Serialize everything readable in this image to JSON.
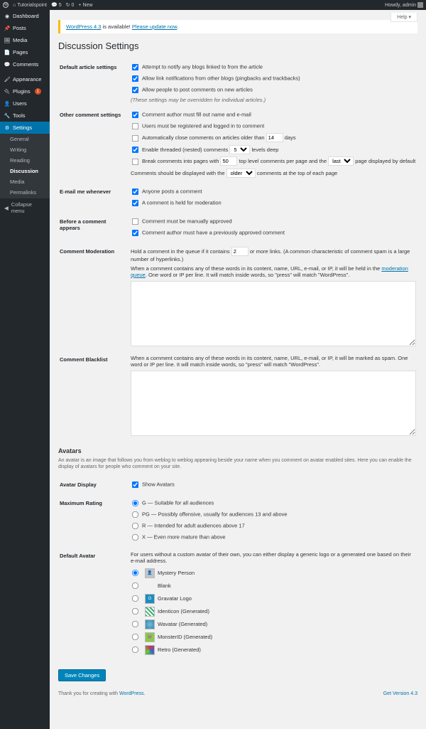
{
  "toolbar": {
    "site_name": "Tutorialspoint",
    "comments_count": "5",
    "updates_count": "0",
    "new_label": "New",
    "greeting": "Howdy, admin"
  },
  "help_tab": "Help ▾",
  "sidebar": {
    "dashboard": "Dashboard",
    "posts": "Posts",
    "media": "Media",
    "pages": "Pages",
    "comments": "Comments",
    "appearance": "Appearance",
    "plugins": "Plugins",
    "plugins_badge": "1",
    "users": "Users",
    "tools": "Tools",
    "settings": "Settings",
    "submenu": {
      "general": "General",
      "writing": "Writing",
      "reading": "Reading",
      "discussion": "Discussion",
      "media": "Media",
      "permalinks": "Permalinks"
    },
    "collapse": "Collapse menu"
  },
  "notice": {
    "prefix": "WordPress 4.3",
    "mid": " is available! ",
    "link": "Please update now",
    "suffix": "."
  },
  "page_title": "Discussion Settings",
  "sections": {
    "default_article": {
      "label": "Default article settings",
      "opt1": "Attempt to notify any blogs linked to from the article",
      "opt2": "Allow link notifications from other blogs (pingbacks and trackbacks)",
      "opt3": "Allow people to post comments on new articles",
      "note": "(These settings may be overridden for individual articles.)"
    },
    "other": {
      "label": "Other comment settings",
      "opt1": "Comment author must fill out name and e-mail",
      "opt2": "Users must be registered and logged in to comment",
      "opt3a": "Automatically close comments on articles older than",
      "opt3_val": "14",
      "opt3b": "days",
      "opt4a": "Enable threaded (nested) comments",
      "opt4_val": "5",
      "opt4b": "levels deep",
      "opt5a": "Break comments into pages with",
      "opt5_val": "50",
      "opt5b": "top level comments per page and the",
      "opt5_sel": "last",
      "opt5c": "page displayed by default",
      "opt6a": "Comments should be displayed with the",
      "opt6_sel": "older",
      "opt6b": "comments at the top of each page"
    },
    "email": {
      "label": "E-mail me whenever",
      "opt1": "Anyone posts a comment",
      "opt2": "A comment is held for moderation"
    },
    "before": {
      "label": "Before a comment appears",
      "opt1": "Comment must be manually approved",
      "opt2": "Comment author must have a previously approved comment"
    },
    "moderation": {
      "label": "Comment Moderation",
      "text1a": "Hold a comment in the queue if it contains",
      "val": "2",
      "text1b": "or more links. (A common characteristic of comment spam is a large number of hyperlinks.)",
      "text2a": "When a comment contains any of these words in its content, name, URL, e-mail, or IP, it will be held in the ",
      "link": "moderation queue",
      "text2b": ". One word or IP per line. It will match inside words, so \"press\" will match \"WordPress\"."
    },
    "blacklist": {
      "label": "Comment Blacklist",
      "text": "When a comment contains any of these words in its content, name, URL, e-mail, or IP, it will be marked as spam. One word or IP per line. It will match inside words, so \"press\" will match \"WordPress\"."
    },
    "avatars": {
      "heading": "Avatars",
      "desc": "An avatar is an image that follows you from weblog to weblog appearing beside your name when you comment on avatar enabled sites. Here you can enable the display of avatars for people who comment on your site.",
      "display_label": "Avatar Display",
      "display_opt": "Show Avatars",
      "rating_label": "Maximum Rating",
      "rating_g": "G — Suitable for all audiences",
      "rating_pg": "PG — Possibly offensive, usually for audiences 13 and above",
      "rating_r": "R — Intended for adult audiences above 17",
      "rating_x": "X — Even more mature than above",
      "default_label": "Default Avatar",
      "default_desc": "For users without a custom avatar of their own, you can either display a generic logo or a generated one based on their e-mail address.",
      "av_mystery": "Mystery Person",
      "av_blank": "Blank",
      "av_gravatar": "Gravatar Logo",
      "av_identicon": "Identicon (Generated)",
      "av_wavatar": "Wavatar (Generated)",
      "av_monster": "MonsterID (Generated)",
      "av_retro": "Retro (Generated)"
    }
  },
  "save_button": "Save Changes",
  "footer": {
    "thanks": "Thank you for creating with ",
    "wp_link": "WordPress",
    "version": "Get Version 4.3"
  }
}
